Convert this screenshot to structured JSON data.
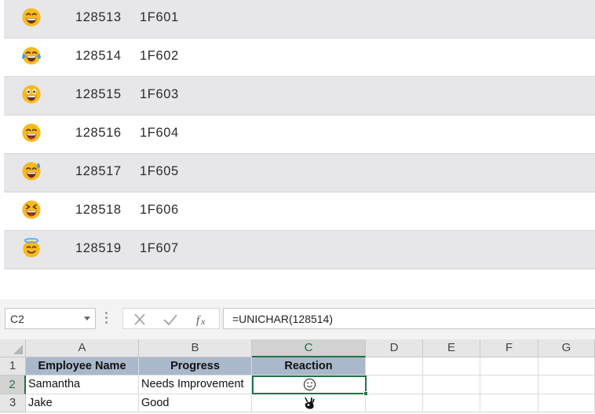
{
  "emoji_table": {
    "rows": [
      {
        "emoji": "😁",
        "icon": "beaming-face-icon",
        "dec": "128513",
        "hex": "1F601"
      },
      {
        "emoji": "😂",
        "icon": "tears-of-joy-face-icon",
        "dec": "128514",
        "hex": "1F602"
      },
      {
        "emoji": "😃",
        "icon": "grinning-big-eyes-face-icon",
        "dec": "128515",
        "hex": "1F603"
      },
      {
        "emoji": "😄",
        "icon": "grinning-smiling-eyes-face-icon",
        "dec": "128516",
        "hex": "1F604"
      },
      {
        "emoji": "😅",
        "icon": "grinning-sweat-face-icon",
        "dec": "128517",
        "hex": "1F605"
      },
      {
        "emoji": "😆",
        "icon": "squinting-face-icon",
        "dec": "128518",
        "hex": "1F606"
      },
      {
        "emoji": "😇",
        "icon": "halo-face-icon",
        "dec": "128519",
        "hex": "1F607"
      }
    ]
  },
  "excel": {
    "name_box": "C2",
    "formula": "=UNICHAR(128514)",
    "columns": [
      "A",
      "B",
      "C",
      "D",
      "E",
      "F",
      "G"
    ],
    "rows": [
      "1",
      "2",
      "3"
    ],
    "headers": [
      "Employee Name",
      "Progress",
      "Reaction"
    ],
    "data": [
      {
        "name": "Samantha",
        "progress": "Needs Improvement",
        "reaction": "😊",
        "reaction_icon": "smiling-face-icon"
      },
      {
        "name": "Jake",
        "progress": "Good",
        "reaction": "👌",
        "reaction_icon": "ok-hand-icon"
      }
    ],
    "colors": {
      "accent": "#217346",
      "header_fill": "#aab8cb"
    }
  }
}
